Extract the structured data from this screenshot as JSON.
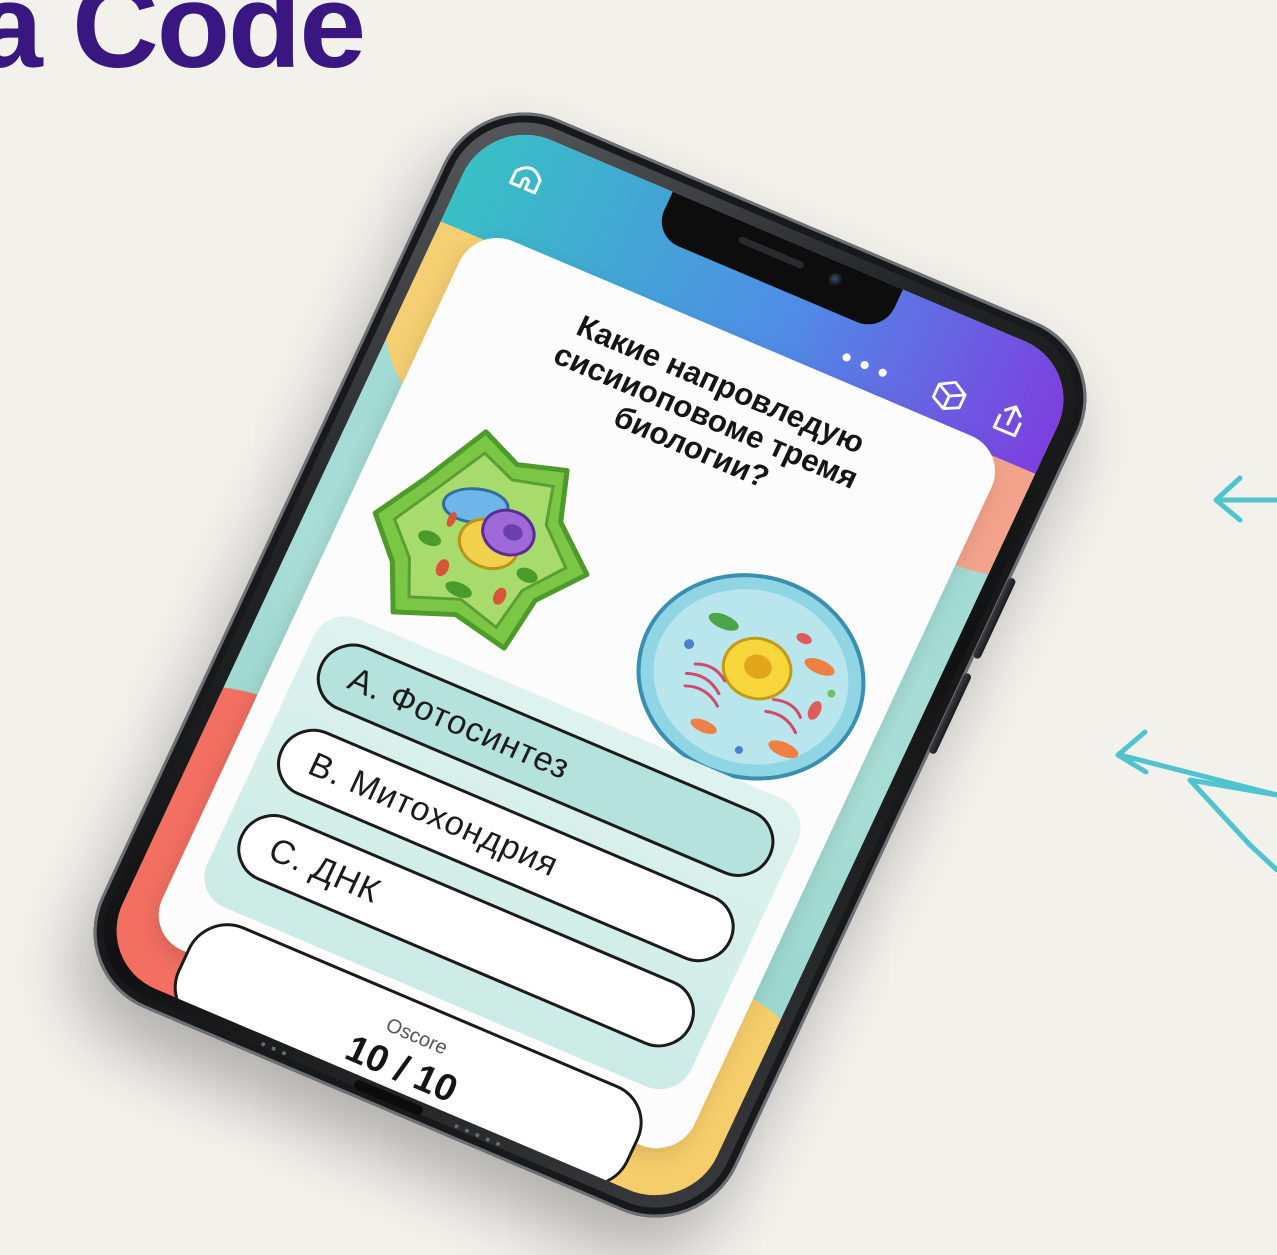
{
  "headline": "a Code",
  "top_bar": {
    "home_icon": "home-icon",
    "more_label": "•••",
    "ar_icon": "ar-cube-icon",
    "share_icon": "share-icon"
  },
  "quiz": {
    "question": "Какие напровледую сисииоповоме тремя биологии?",
    "images": [
      "plant-cell-illustration",
      "animal-cell-illustration"
    ],
    "answers": [
      {
        "label": "А. Фотосинтез",
        "selected": true
      },
      {
        "label": "В. Митохондрия",
        "selected": false
      },
      {
        "label": "С. ДНК",
        "selected": false
      }
    ],
    "score": {
      "label": "Oscore",
      "value": "10 / 10"
    }
  },
  "colors": {
    "headline": "#3a1680",
    "topbar_start": "#38c0c4",
    "topbar_end": "#7d3fe0",
    "selected_answer": "#b6e2dd",
    "arrows": "#4fc4cf"
  }
}
